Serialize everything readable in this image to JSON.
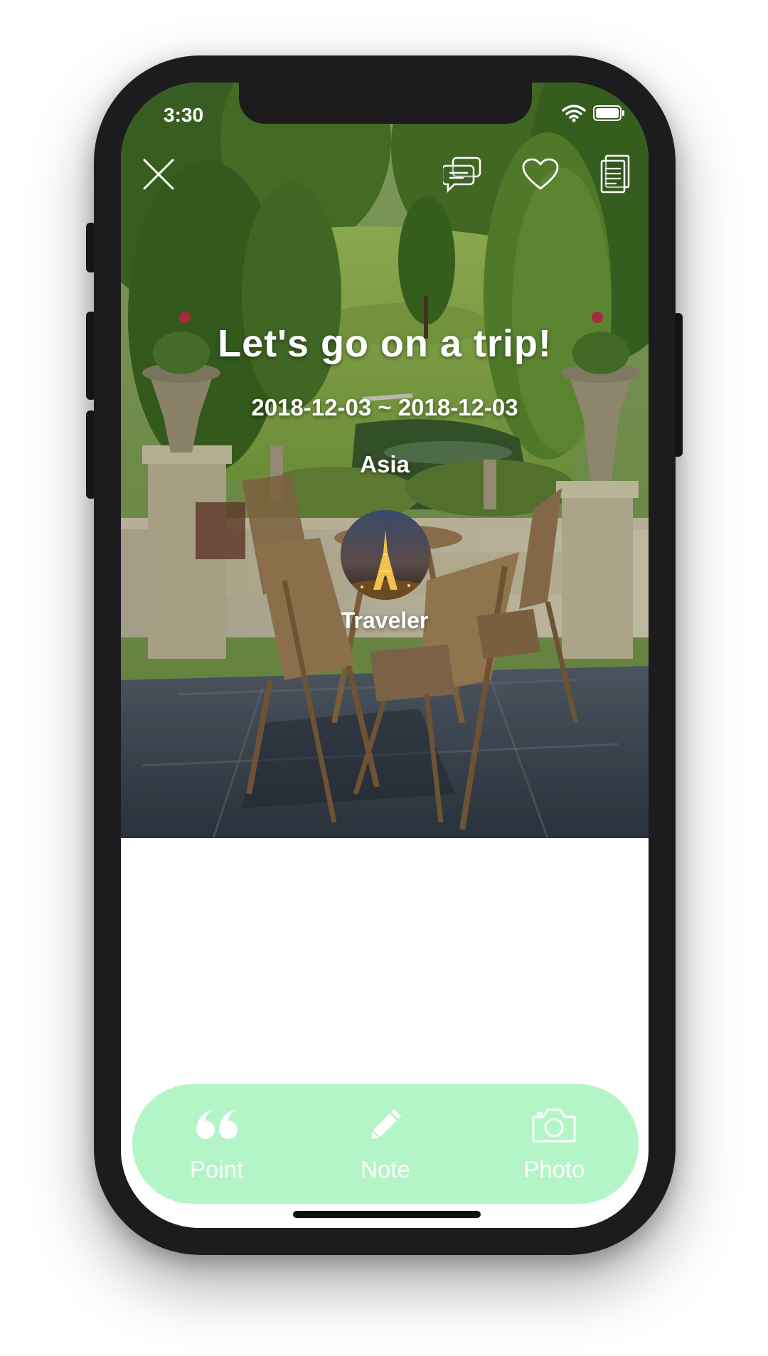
{
  "status_bar": {
    "time": "3:30",
    "wifi_icon": "wifi-icon",
    "battery_icon": "battery-icon"
  },
  "toolbar": {
    "close_icon": "close-icon",
    "comments_icon": "comments-icon",
    "like_icon": "heart-icon",
    "document_icon": "document-icon"
  },
  "trip": {
    "title": "Let's go on a trip!",
    "dates": "2018-12-03 ~ 2018-12-03",
    "region": "Asia",
    "traveler": "Traveler"
  },
  "actions": [
    {
      "label": "Point",
      "icon": "quote-icon"
    },
    {
      "label": "Note",
      "icon": "pencil-icon"
    },
    {
      "label": "Photo",
      "icon": "camera-icon"
    }
  ],
  "colors": {
    "action_bar": "#b3f5c6",
    "phone_frame": "#1c1c1e",
    "text": "#ffffff"
  }
}
